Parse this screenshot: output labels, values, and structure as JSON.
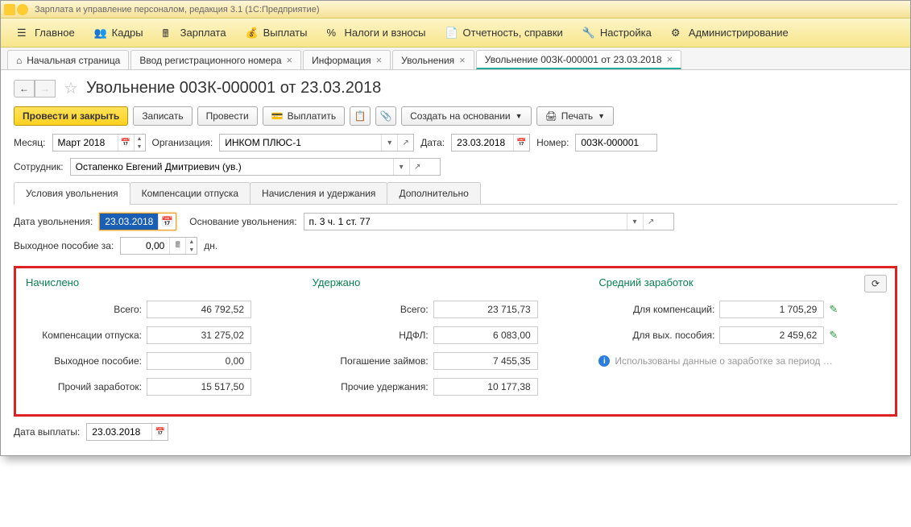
{
  "titlebar": "Зарплата и управление персоналом, редакция 3.1  (1С:Предприятие)",
  "topmenu": [
    {
      "label": "Главное"
    },
    {
      "label": "Кадры"
    },
    {
      "label": "Зарплата"
    },
    {
      "label": "Выплаты"
    },
    {
      "label": "Налоги и взносы"
    },
    {
      "label": "Отчетность, справки"
    },
    {
      "label": "Настройка"
    },
    {
      "label": "Администрирование"
    }
  ],
  "tabs": {
    "home": "Начальная страница",
    "t1": "Ввод регистрационного номера",
    "t2": "Информация",
    "t3": "Увольнения",
    "t4": "Увольнение 00ЗК-000001 от 23.03.2018"
  },
  "pagetitle": "Увольнение 00ЗК-000001 от 23.03.2018",
  "toolbar": {
    "post_close": "Провести и закрыть",
    "save": "Записать",
    "post": "Провести",
    "pay": "Выплатить",
    "create_based": "Создать на основании",
    "print": "Печать"
  },
  "form": {
    "month_lbl": "Месяц:",
    "month_val": "Март 2018",
    "org_lbl": "Организация:",
    "org_val": "ИНКОМ ПЛЮС-1",
    "date_lbl": "Дата:",
    "date_val": "23.03.2018",
    "num_lbl": "Номер:",
    "num_val": "00ЗК-000001",
    "emp_lbl": "Сотрудник:",
    "emp_val": "Остапенко Евгений Дмитриевич (ув.)"
  },
  "subtabs": {
    "t1": "Условия увольнения",
    "t2": "Компенсации отпуска",
    "t3": "Начисления и удержания",
    "t4": "Дополнительно"
  },
  "dismissal": {
    "date_lbl": "Дата увольнения:",
    "date_val": "23.03.2018",
    "basis_lbl": "Основание увольнения:",
    "basis_val": "п. 3 ч. 1 ст. 77",
    "sev_lbl": "Выходное пособие за:",
    "sev_val": "0,00",
    "sev_unit": "дн."
  },
  "totals": {
    "accrued_h": "Начислено",
    "withheld_h": "Удержано",
    "avg_h": "Средний заработок",
    "accrued": {
      "total_lbl": "Всего:",
      "total": "46 792,52",
      "comp_lbl": "Компенсации отпуска:",
      "comp": "31 275,02",
      "sev_lbl": "Выходное пособие:",
      "sev": "0,00",
      "other_lbl": "Прочий заработок:",
      "other": "15 517,50"
    },
    "withheld": {
      "total_lbl": "Всего:",
      "total": "23 715,73",
      "ndfl_lbl": "НДФЛ:",
      "ndfl": "6 083,00",
      "loan_lbl": "Погашение займов:",
      "loan": "7 455,35",
      "other_lbl": "Прочие удержания:",
      "other": "10 177,38"
    },
    "avg": {
      "comp_lbl": "Для компенсаций:",
      "comp": "1 705,29",
      "sev_lbl": "Для вых. пособия:",
      "sev": "2 459,62",
      "info": "Использованы данные о заработке за период …"
    }
  },
  "paydate": {
    "lbl": "Дата выплаты:",
    "val": "23.03.2018"
  }
}
